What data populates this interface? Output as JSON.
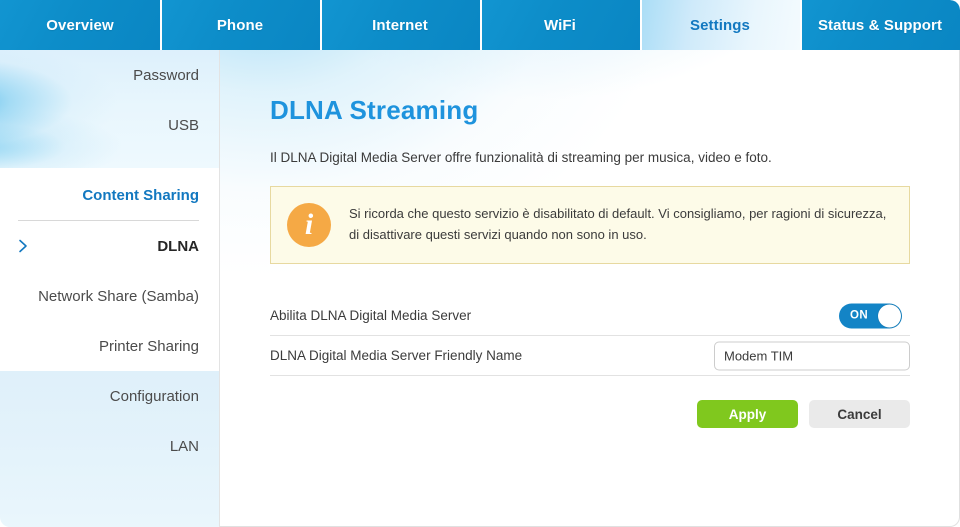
{
  "topnav": {
    "tabs": [
      {
        "label": "Overview",
        "active": false
      },
      {
        "label": "Phone",
        "active": false
      },
      {
        "label": "Internet",
        "active": false
      },
      {
        "label": "WiFi",
        "active": false
      },
      {
        "label": "Settings",
        "active": true
      },
      {
        "label": "Status & Support",
        "active": false
      }
    ]
  },
  "sidebar": {
    "top_items": [
      {
        "label": "Password"
      },
      {
        "label": "USB"
      }
    ],
    "section_heading": "Content Sharing",
    "section_items": [
      {
        "label": "DLNA",
        "current": true,
        "chevron": "chevron-right-icon"
      },
      {
        "label": "Network Share (Samba)",
        "current": false
      },
      {
        "label": "Printer Sharing",
        "current": false
      }
    ],
    "bottom_items": [
      {
        "label": "Configuration"
      },
      {
        "label": "LAN"
      }
    ]
  },
  "main": {
    "title": "DLNA Streaming",
    "description": "Il DLNA Digital Media Server offre funzionalità di streaming per musica, video e foto.",
    "notice": {
      "icon": "info-icon",
      "icon_glyph": "i",
      "text": "Si ricorda che questo servizio è disabilitato di default. Vi consigliamo, per ragioni di sicurezza, di disattivare questi servizi quando non sono in uso."
    },
    "rows": {
      "enable": {
        "label": "Abilita DLNA Digital Media Server",
        "toggle_state": "ON"
      },
      "friendly_name": {
        "label": "DLNA Digital Media Server Friendly Name",
        "value": "Modem TIM",
        "placeholder": ""
      }
    },
    "buttons": {
      "apply": "Apply",
      "cancel": "Cancel"
    }
  },
  "colors": {
    "nav_blue": "#0d8fcc",
    "accent_blue": "#1278c0",
    "title_blue": "#1e93dd",
    "toggle_on": "#1384c6",
    "apply_green": "#80c81e",
    "notice_bg": "#fdfbe8",
    "notice_border": "#e7d9a0",
    "info_orange": "#f5a945"
  }
}
